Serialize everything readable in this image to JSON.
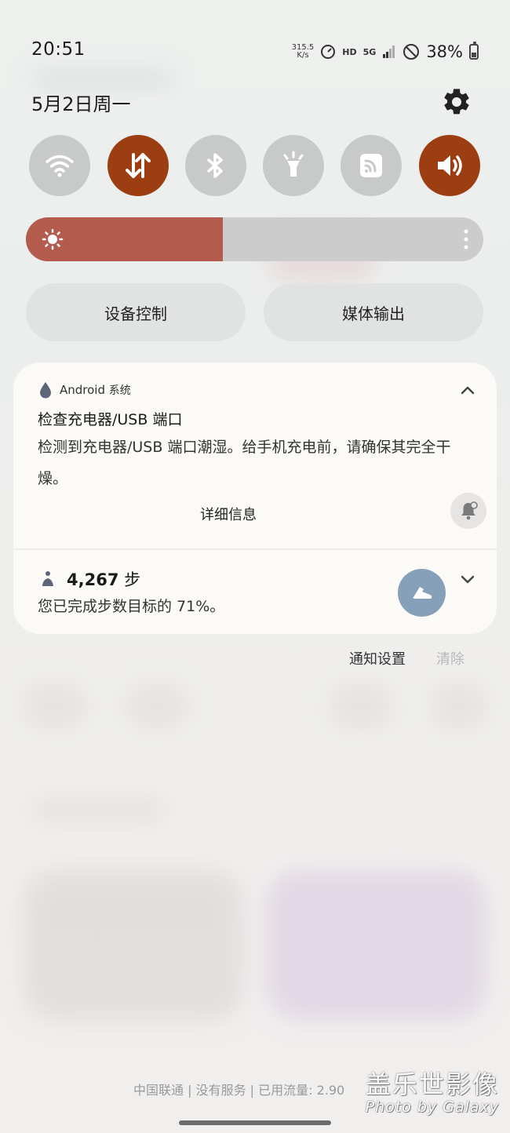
{
  "status_bar": {
    "time": "20:51",
    "net_speed_value": "315.5",
    "net_speed_unit": "K/s",
    "hd_label": "HD",
    "network_label": "5G",
    "battery_percent": "38%",
    "battery_level": 0.38
  },
  "quick_panel": {
    "date": "5月2日周一",
    "toggles": [
      {
        "name": "wifi",
        "on": false
      },
      {
        "name": "mobile-data",
        "on": true
      },
      {
        "name": "bluetooth",
        "on": false
      },
      {
        "name": "flashlight",
        "on": false
      },
      {
        "name": "nfc",
        "on": false
      },
      {
        "name": "sound",
        "on": true
      }
    ],
    "brightness_level": 0.43,
    "device_control_label": "设备控制",
    "media_output_label": "媒体输出"
  },
  "notification": {
    "app_name": "Android",
    "app_suffix": "系统",
    "title": "检查充电器/USB 端口",
    "body": "检测到充电器/USB 端口潮湿。给手机充电前，请确保其完全干燥。",
    "action_label": "详细信息"
  },
  "steps": {
    "count": "4,267",
    "unit": "步",
    "message": "您已完成步数目标的 71%。"
  },
  "footer": {
    "notification_settings_label": "通知设置",
    "clear_label": "清除",
    "carrier_text": "中国联通 | 没有服务 | 已用流量: 2.90",
    "watermark_line1": "盖乐世影像",
    "watermark_line2": "Photo by Galaxy"
  },
  "colors": {
    "toggle_on": "#9d3d12",
    "toggle_off": "#c8cac9",
    "brightness_fill": "#b35b4d",
    "steps_button": "#86a0ba"
  }
}
